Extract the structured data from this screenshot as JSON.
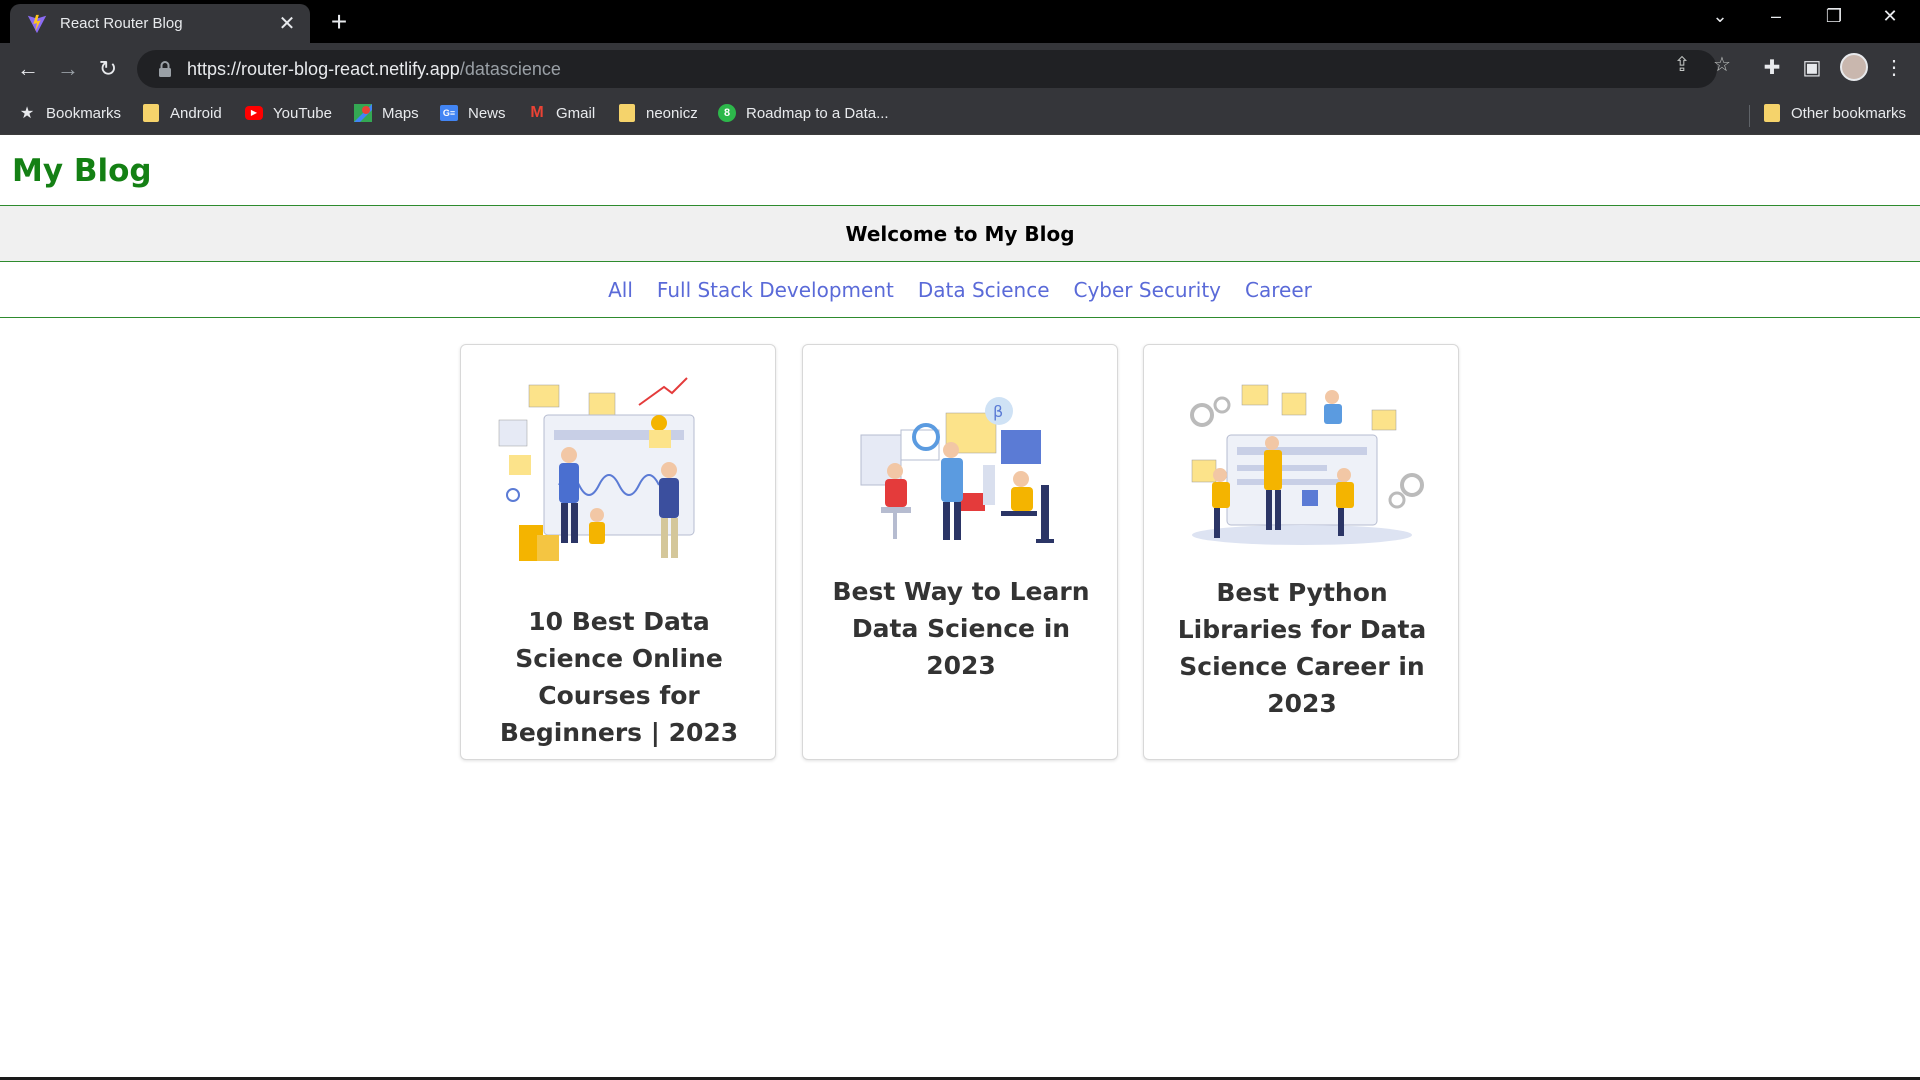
{
  "browser": {
    "tab_title": "React Router Blog",
    "url_host": "https://router-blog-react.netlify.app",
    "url_path": "/datascience",
    "bookmarks": [
      {
        "label": "Bookmarks",
        "icon": "star-icon"
      },
      {
        "label": "Android",
        "icon": "folder-icon"
      },
      {
        "label": "YouTube",
        "icon": "youtube-icon"
      },
      {
        "label": "Maps",
        "icon": "maps-icon"
      },
      {
        "label": "News",
        "icon": "news-icon"
      },
      {
        "label": "Gmail",
        "icon": "gmail-icon"
      },
      {
        "label": "neonicz",
        "icon": "folder-icon"
      },
      {
        "label": "Roadmap to a Data...",
        "icon": "roadmap-icon"
      }
    ],
    "other_bookmarks": "Other bookmarks"
  },
  "site": {
    "brand": "My Blog",
    "welcome": "Welcome to My Blog",
    "nav": [
      "All",
      "Full Stack Development",
      "Data Science",
      "Cyber Security",
      "Career"
    ],
    "nav_color": "#5a6ad8",
    "brand_color": "#148014"
  },
  "posts": [
    {
      "title": "10 Best Data Science Online Courses for Beginners | 2023"
    },
    {
      "title": "Best Way to Learn Data Science in 2023"
    },
    {
      "title": "Best Python Libraries for Data Science Career in 2023"
    }
  ]
}
